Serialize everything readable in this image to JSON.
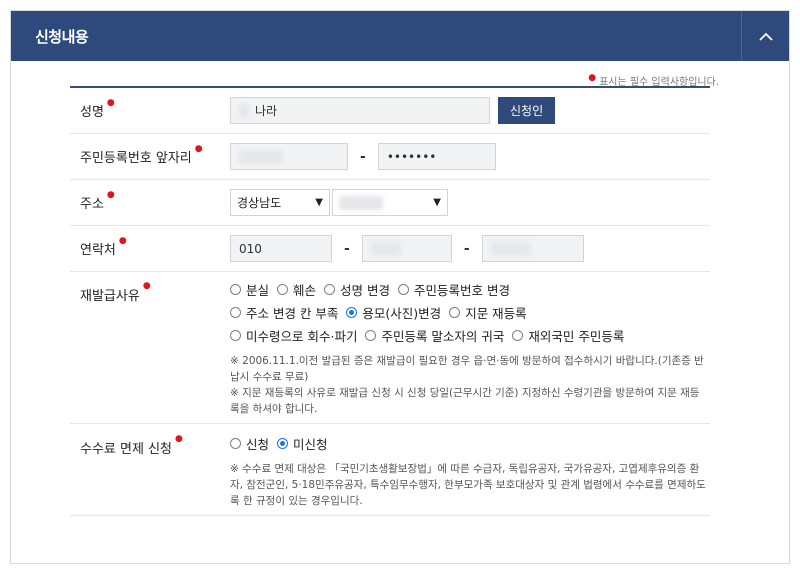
{
  "header": {
    "title": "신청내용"
  },
  "required_note": "표시는 필수 입력사항입니다.",
  "fields": {
    "name": {
      "label": "성명",
      "value": "나라",
      "button": "신청인"
    },
    "rrn": {
      "label": "주민등록번호 앞자리",
      "back_value": "•••••••"
    },
    "address": {
      "label": "주소",
      "province": "경상남도"
    },
    "contact": {
      "label": "연락처",
      "prefix": "010"
    },
    "reason": {
      "label": "재발급사유",
      "options": [
        "분실",
        "훼손",
        "성명 변경",
        "주민등록번호 변경",
        "주소 변경 칸 부족",
        "용모(사진)변경",
        "지문 재등록",
        "미수령으로 회수·파기",
        "주민등록 말소자의 귀국",
        "재외국민 주민등록"
      ],
      "selected": "용모(사진)변경",
      "note1": "※ 2006.11.1.이전 발급된 증은 재발급이 필요한 경우 읍·면·동에 방문하여 접수하시기 바랍니다.(기존증 반납시 수수료 무료)",
      "note2": "※ 지문 재등록의 사유로 재발급 신청 시 신청 당일(근무시간 기준) 지정하신 수령기관을 방문하여 지문 재등록을 하셔야 합니다."
    },
    "fee": {
      "label": "수수료 면제 신청",
      "options": [
        "신청",
        "미신청"
      ],
      "selected": "미신청",
      "note": "※ 수수료 면제 대상은 「국민기초생활보장법」에 따른 수급자, 독립유공자, 국가유공자, 고엽제후유의증 환자, 참전군인, 5·18민주유공자, 특수임무수행자, 한부모가족 보호대상자 및 관계 법령에서 수수료를 면제하도록 한 규정이 있는 경우입니다."
    }
  },
  "colors": {
    "header_bg": "#2e4a7d",
    "button_bg": "#2d4a7a",
    "required": "#e0161e",
    "radio_on": "#1a73e8"
  }
}
